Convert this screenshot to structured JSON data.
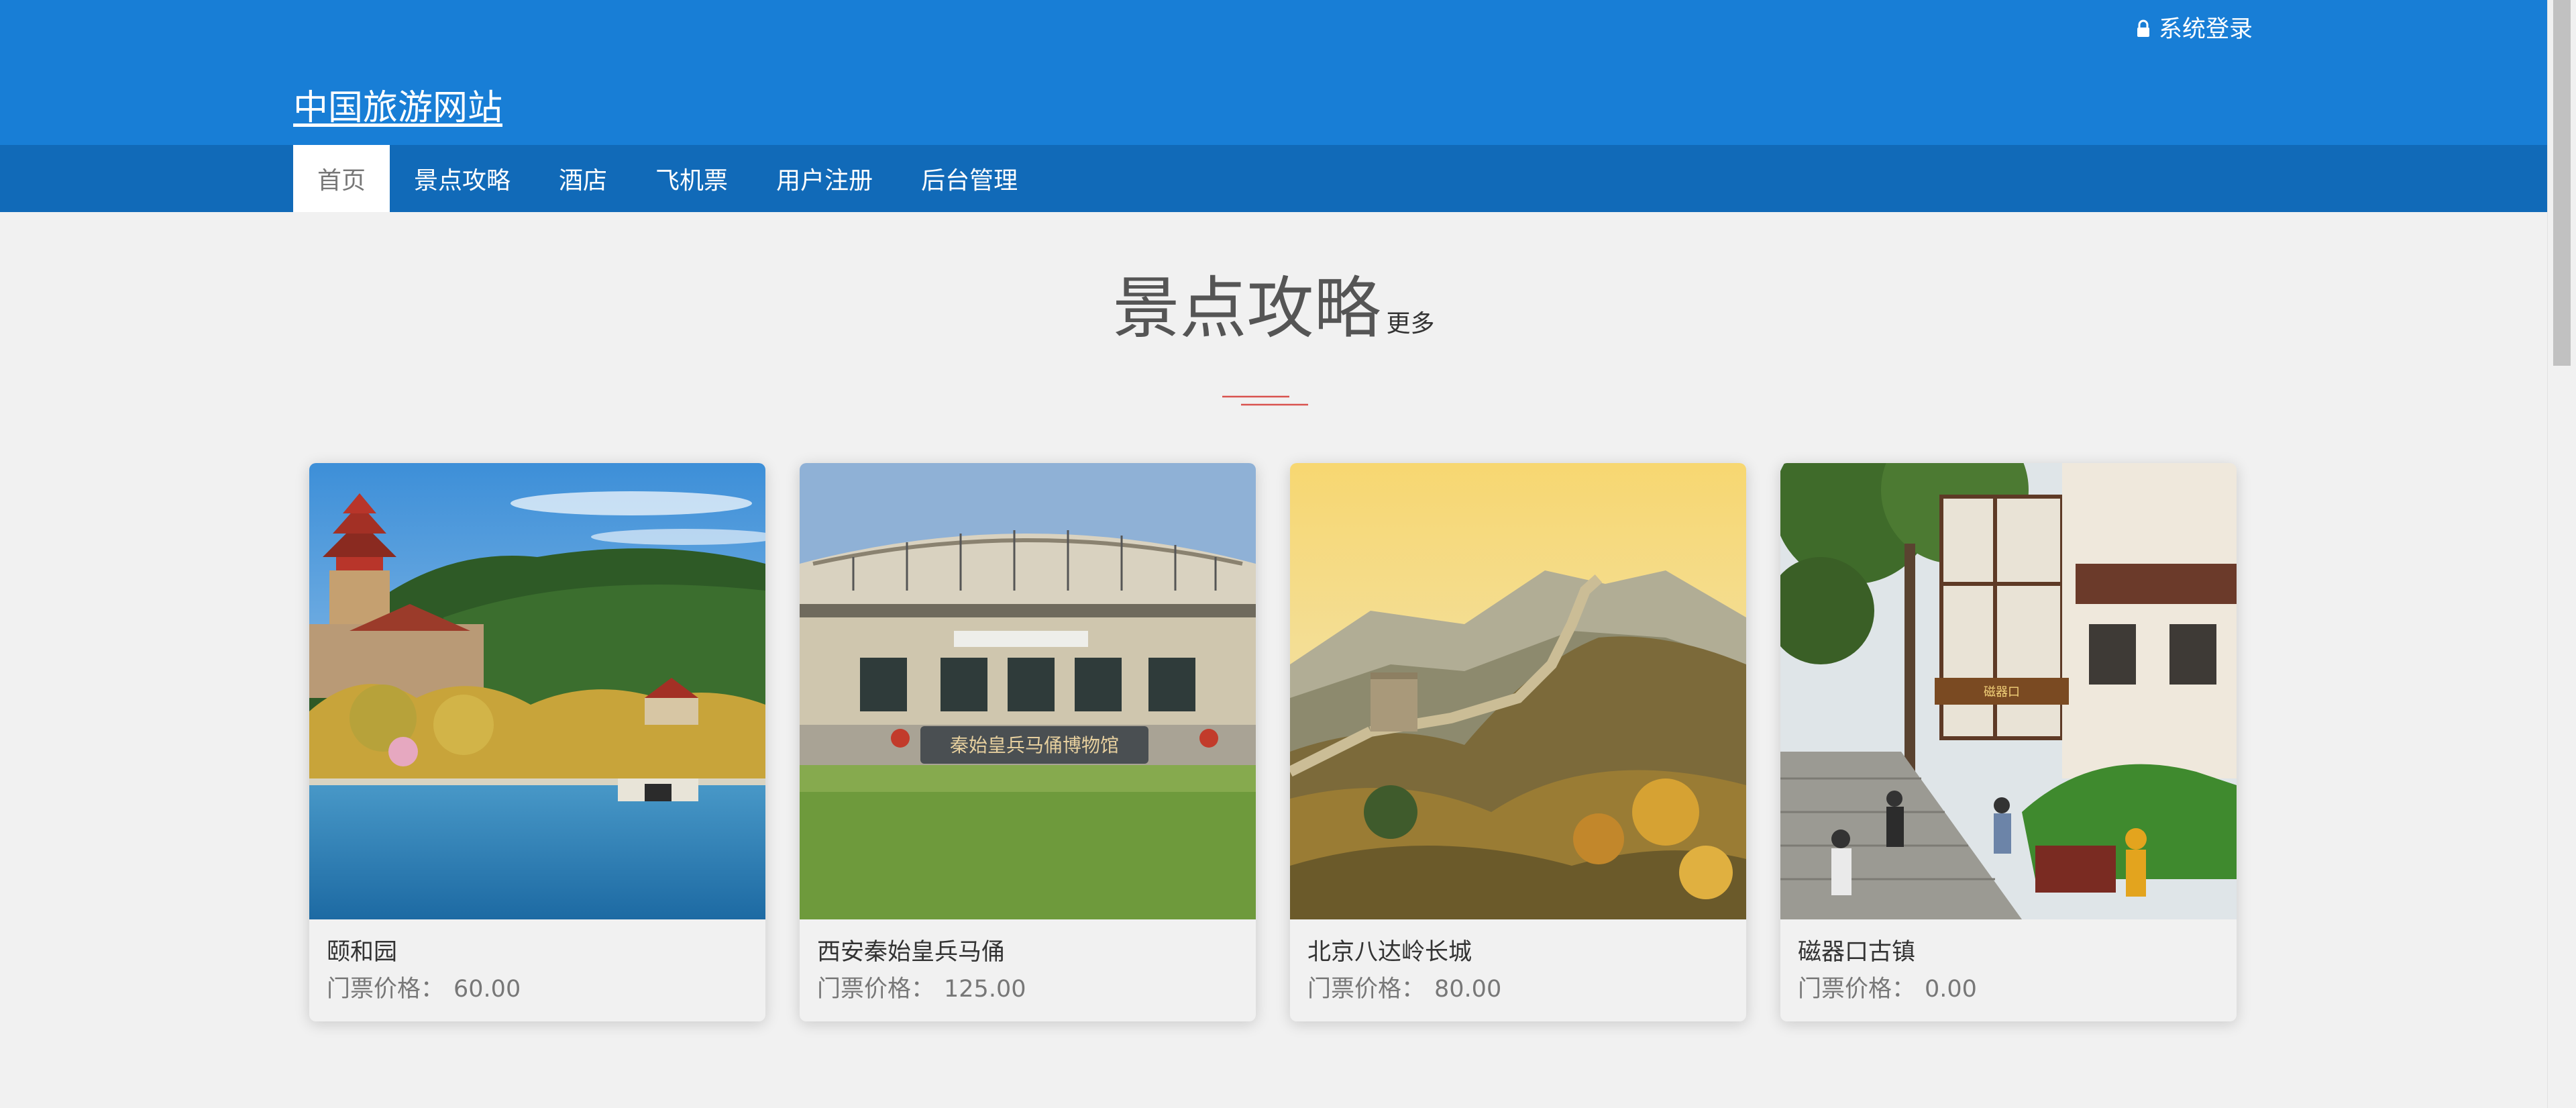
{
  "header": {
    "login_label": "系统登录",
    "site_title": "中国旅游网站"
  },
  "nav": {
    "items": [
      {
        "label": "首页",
        "active": true
      },
      {
        "label": "景点攻略",
        "active": false
      },
      {
        "label": "酒店",
        "active": false
      },
      {
        "label": "飞机票",
        "active": false
      },
      {
        "label": "用户注册",
        "active": false
      },
      {
        "label": "后台管理",
        "active": false
      }
    ]
  },
  "section": {
    "title": "景点攻略",
    "more_label": "更多"
  },
  "cards": [
    {
      "name": "颐和园",
      "price_label": "门票价格：",
      "price": "60.00"
    },
    {
      "name": "西安秦始皇兵马俑",
      "price_label": "门票价格：",
      "price": "125.00"
    },
    {
      "name": "北京八达岭长城",
      "price_label": "门票价格：",
      "price": "80.00"
    },
    {
      "name": "磁器口古镇",
      "price_label": "门票价格：",
      "price": "0.00"
    }
  ],
  "colors": {
    "header_blue": "#187ed6",
    "nav_blue": "#116ab8",
    "divider_red": "#d9534f"
  },
  "icons": {
    "login": "lock-icon"
  }
}
